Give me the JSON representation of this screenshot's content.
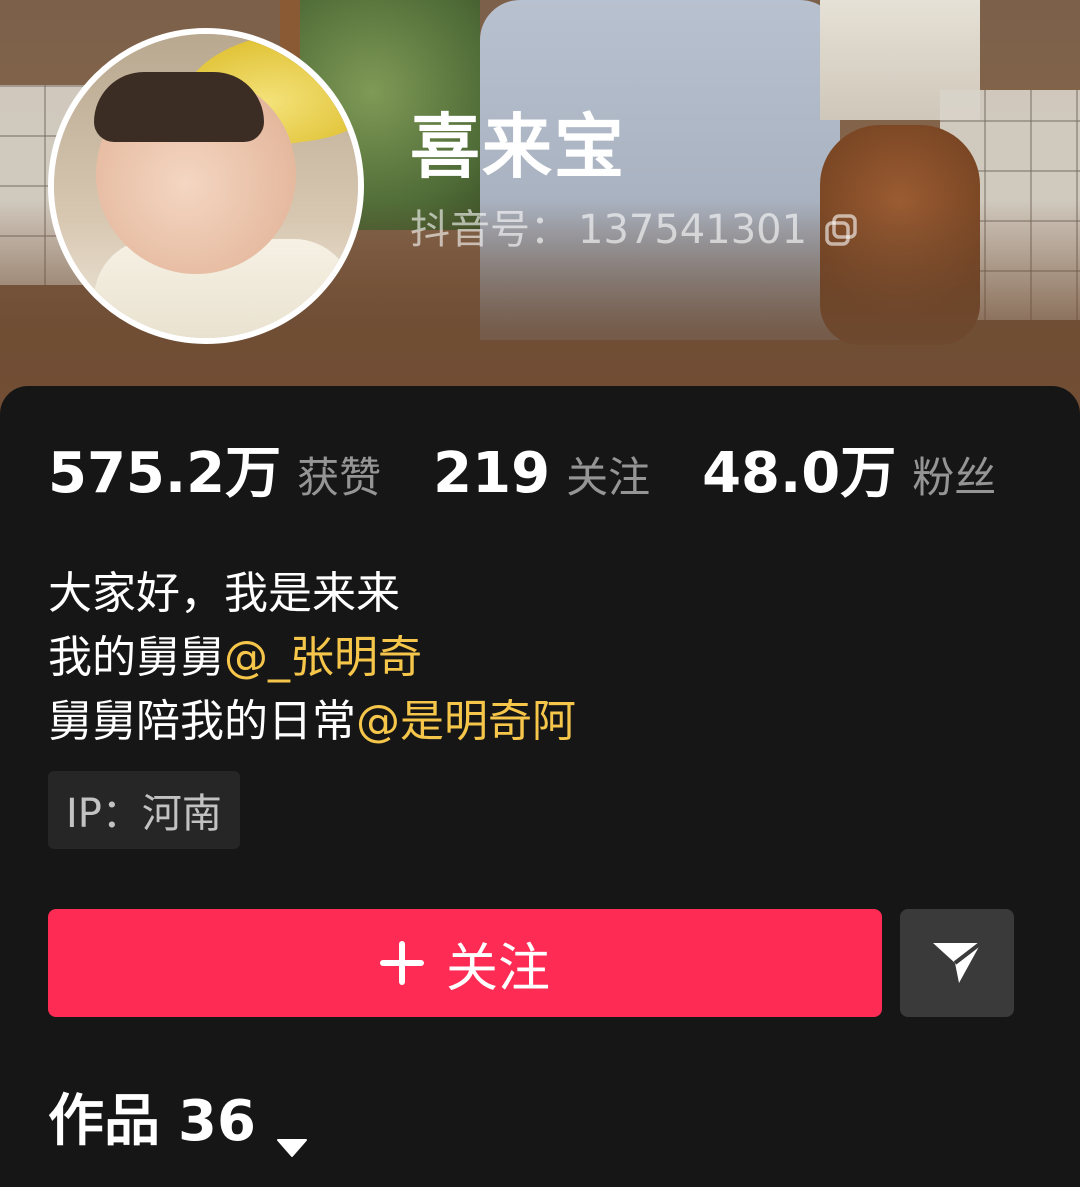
{
  "profile": {
    "name": "喜来宝",
    "douyin_id_prefix": "抖音号：",
    "douyin_id": "137541301"
  },
  "stats": [
    {
      "value": "575.2万",
      "label": "获赞"
    },
    {
      "value": "219",
      "label": "关注"
    },
    {
      "value": "48.0万",
      "label": "粉丝"
    }
  ],
  "bio": {
    "line1": "大家好，我是来来",
    "line2_text": "我的舅舅",
    "line2_mention": "@_张明奇",
    "line3_text": "舅舅陪我的日常",
    "line3_mention": "@是明奇阿"
  },
  "ip_tag": "IP：河南",
  "actions": {
    "follow_label": "关注",
    "share_icon": "send-icon"
  },
  "tabs": {
    "works_label": "作品",
    "works_count": "36"
  },
  "colors": {
    "accent": "#fe2c55",
    "mention": "#f5c64a",
    "background": "#161616"
  }
}
